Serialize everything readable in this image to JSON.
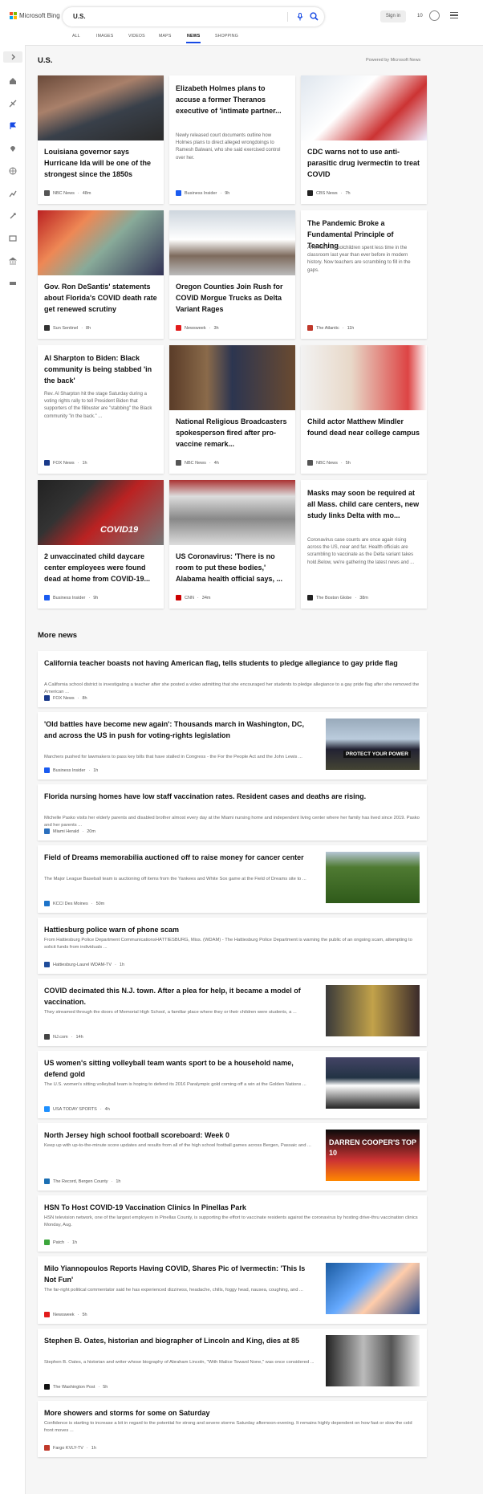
{
  "header": {
    "logo_text": "Microsoft Bing",
    "search_value": "U.S.",
    "sign_in": "Sign in",
    "points": "10"
  },
  "scopes": [
    "ALL",
    "IMAGES",
    "VIDEOS",
    "MAPS",
    "NEWS",
    "SHOPPING"
  ],
  "active_scope": "NEWS",
  "section": {
    "title": "U.S.",
    "powered_by": "Powered by Microsoft News"
  },
  "cards": [
    {
      "title": "Louisiana governor says Hurricane Ida will be one of the strongest since the 1850s",
      "desc": "",
      "source": "NBC News",
      "age": "48m",
      "has_image": true
    },
    {
      "title": "Elizabeth Holmes plans to accuse a former Theranos executive of 'intimate partner...",
      "desc": "Newly released court documents outline how Holmes plans to direct alleged wrongdoings to Ramesh Balwani, who she said exercised control over her.",
      "source": "Business Insider",
      "age": "9h",
      "has_image": false
    },
    {
      "title": "CDC warns not to use anti-parasitic drug ivermectin to treat COVID",
      "desc": "",
      "source": "CBS News",
      "age": "7h",
      "has_image": true
    },
    {
      "title": "Gov. Ron DeSantis' statements about Florida's COVID death rate get renewed scrutiny",
      "desc": "",
      "source": "Sun Sentinel",
      "age": "8h",
      "has_image": true
    },
    {
      "title": "Oregon Counties Join Rush for COVID Morgue Trucks as Delta Variant Rages",
      "desc": "",
      "source": "Newsweek",
      "age": "3h",
      "has_image": true
    },
    {
      "title": "The Pandemic Broke a Fundamental Principle of Teaching",
      "desc": "America's schoolchildren spent less time in the classroom last year than ever before in modern history. Now teachers are scrambling to fill in the gaps.",
      "source": "The Atlantic",
      "age": "11h",
      "has_image": false
    },
    {
      "title": "Al Sharpton to Biden: Black community is being stabbed 'in the back'",
      "desc": "Rev. Al Sharpton hit the stage Saturday during a voting rights rally to tell President Biden that supporters of the filibuster are \"stabbing\" the Black community \"in the back.\" ...",
      "source": "FOX News",
      "age": "1h",
      "has_image": false
    },
    {
      "title": "National Religious Broadcasters spokesperson fired after pro-vaccine remark...",
      "desc": "",
      "source": "NBC News",
      "age": "4h",
      "has_image": true
    },
    {
      "title": "Child actor Matthew Mindler found dead near college campus",
      "desc": "",
      "source": "NBC News",
      "age": "5h",
      "has_image": true
    },
    {
      "title": "2 unvaccinated child daycare center employees were found dead at home from COVID-19...",
      "desc": "",
      "source": "Business Insider",
      "age": "9h",
      "has_image": true
    },
    {
      "title": "US Coronavirus: 'There is no room to put these bodies,' Alabama health official says, ...",
      "desc": "",
      "source": "CNN",
      "age": "34m",
      "has_image": true
    },
    {
      "title": "Masks may soon be required at all Mass. child care centers, new study links Delta with mo...",
      "desc": "Coronavirus case counts are once again rising across the US, near and far. Health officials are scrambling to vaccinate as the Delta variant takes hold.Below, we're gathering the latest news and ...",
      "source": "The Boston Globe",
      "age": "38m",
      "has_image": false
    }
  ],
  "more_news": {
    "title": "More news",
    "items": [
      {
        "title": "California teacher boasts not having American flag, tells students to pledge allegiance to gay pride flag",
        "desc": "A California school district is investigating a teacher after she posted a video admitting that she encouraged her students to pledge allegiance to a gay pride flag after she removed the American ...",
        "source": "FOX News",
        "age": "8h",
        "has_image": false
      },
      {
        "title": "'Old battles have become new again': Thousands march in Washington, DC, and across the US in push for voting-rights legislation",
        "desc": "Marchers pushed for lawmakers to pass key bills that have stalled in Congress - the For the People Act and the John Lewis ...",
        "source": "Business Insider",
        "age": "1h",
        "has_image": true,
        "image_text": "PROTECT YOUR POWER"
      },
      {
        "title": "Florida nursing homes have low staff vaccination rates. Resident cases and deaths are rising.",
        "desc": "Michelle Pasko visits her elderly parents and disabled brother almost every day at the Miami nursing home and independent living center where her family has lived since 2019. Pasko and her parents ...",
        "source": "Miami Herald",
        "age": "20m",
        "has_image": false
      },
      {
        "title": "Field of Dreams memorabilia auctioned off to raise money for cancer center",
        "desc": "The Major League Baseball team is auctioning off items from the Yankees and White Sox game at the Field of Dreams site to ...",
        "source": "KCCI Des Moines",
        "age": "50m",
        "has_image": true
      },
      {
        "title": "Hattiesburg police warn of phone scam",
        "desc": "From Hattiesburg Police Department CommunicationsHATTIESBURG, Miss. (WDAM) - The Hattiesburg Police Department is warning the public of an ongoing scam, attempting to solicit funds from individuals ...",
        "source": "Hattiesburg-Laurel WDAM-TV",
        "age": "1h",
        "has_image": false
      },
      {
        "title": "COVID decimated this N.J. town. After a plea for help, it became a model of vaccination.",
        "desc": "They streamed through the doors of Memorial High School, a familiar place where they or their children were students, a ...",
        "source": "NJ.com",
        "age": "14h",
        "has_image": true
      },
      {
        "title": "US women's sitting volleyball team wants sport to be a household name, defend gold",
        "desc": "The U.S. women's sitting volleyball team is hoping to defend its 2016 Paralympic gold coming off a win at the Golden Nations ...",
        "source": "USA TODAY SPORTS",
        "age": "4h",
        "has_image": true
      },
      {
        "title": "North Jersey high school football scoreboard: Week 0",
        "desc": "Keep up with up-to-the-minute score updates and results from all of the high school football games across Bergen, Passaic and ...",
        "source": "The Record, Bergen County",
        "age": "1h",
        "has_image": true,
        "image_text": "DARREN COOPER'S TOP 10"
      },
      {
        "title": "HSN To Host COVID-19 Vaccination Clinics In Pinellas Park",
        "desc": "HSN television network, one of the largest employers in Pinellas County, is supporting the effort to vaccinate residents against the coronavirus by hosting drive-thru vaccination clinics Monday, Aug.",
        "source": "Patch",
        "age": "1h",
        "has_image": false
      },
      {
        "title": "Milo Yiannopoulos Reports Having COVID, Shares Pic of Ivermectin: 'This Is Not Fun'",
        "desc": "The far-right political commentator said he has experienced dizziness, headache, chills, foggy head, nausea, coughing, and ...",
        "source": "Newsweek",
        "age": "5h",
        "has_image": true
      },
      {
        "title": "Stephen B. Oates, historian and biographer of Lincoln and King, dies at 85",
        "desc": "Stephen B. Oates, a historian and writer whose biography of Abraham Lincoln, \"With Malice Toward None,\" was once considered ...",
        "source": "The Washington Post",
        "age": "5h",
        "has_image": true
      },
      {
        "title": "More showers and storms for some on Saturday",
        "desc": "Confidence is starting to increase a bit in regard to the potential for strong and severe storms Saturday afternoon-evening. It remains highly dependent on how fast or slow the cold front moves ...",
        "source": "Fargo KVLY-TV",
        "age": "1h",
        "has_image": false
      }
    ]
  },
  "colors": {
    "accent": "#174ae4",
    "background": "#f6f6f6",
    "card": "#ffffff"
  }
}
